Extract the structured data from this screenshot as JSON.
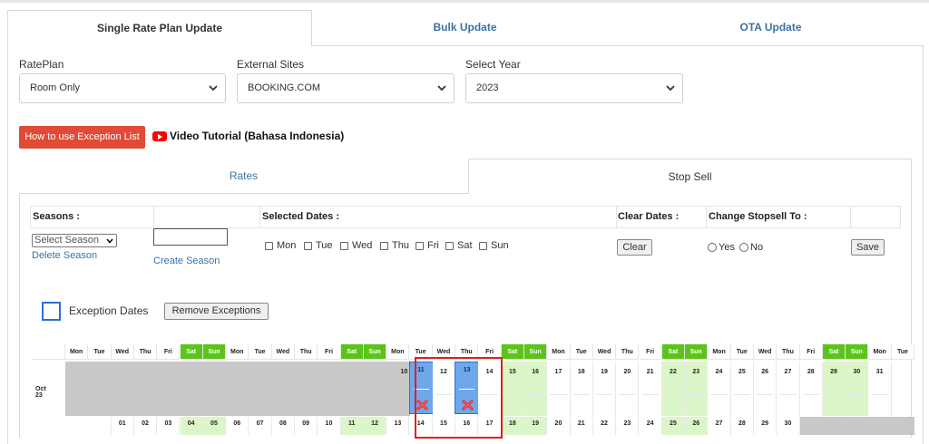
{
  "main_tabs": [
    "Single Rate Plan Update",
    "Bulk Update",
    "OTA Update"
  ],
  "form": {
    "rateplan_label": "RatePlan",
    "rateplan_value": "Room Only",
    "sites_label": "External Sites",
    "sites_value": "BOOKING.COM",
    "year_label": "Select Year",
    "year_value": "2023"
  },
  "help_button": "How to use Exception List",
  "video_link": "Video Tutorial (Bahasa Indonesia)",
  "sub_tabs": [
    "Rates",
    "Stop Sell"
  ],
  "stopsell": {
    "seasons_header": "Seasons :",
    "selected_dates_header": "Selected Dates :",
    "clear_dates_header": "Clear Dates :",
    "change_header": "Change Stopsell To :",
    "season_select": "Select Season",
    "delete_season": "Delete Season",
    "create_season": "Create Season",
    "weekdays": [
      "Mon",
      "Tue",
      "Wed",
      "Thu",
      "Fri",
      "Sat",
      "Sun"
    ],
    "clear_button": "Clear",
    "yes_label": "Yes",
    "no_label": "No",
    "save_button": "Save"
  },
  "exceptions": {
    "label": "Exception Dates",
    "remove_button": "Remove Exceptions"
  },
  "calendar": {
    "header_days": [
      "Mon",
      "Tue",
      "Wed",
      "Thu",
      "Fri",
      "Sat",
      "Sun",
      "Mon",
      "Tue",
      "Wed",
      "Thu",
      "Fri",
      "Sat",
      "Sun",
      "Mon",
      "Tue",
      "Wed",
      "Thu",
      "Fri",
      "Sat",
      "Sun",
      "Mon",
      "Tue",
      "Wed",
      "Thu",
      "Fri",
      "Sat",
      "Sun",
      "Mon",
      "Tue",
      "Wed",
      "Thu",
      "Fri",
      "Sat",
      "Sun",
      "Mon",
      "Tue"
    ],
    "month_label": "Oct 23",
    "oct_days": [
      "10",
      "11",
      "12",
      "13",
      "14",
      "15",
      "16",
      "17",
      "18",
      "19",
      "20",
      "21",
      "22",
      "23",
      "24",
      "25",
      "26",
      "27",
      "28",
      "29",
      "30",
      "31"
    ],
    "oct_exceptions": [
      "11",
      "13"
    ],
    "nov_days": [
      "01",
      "02",
      "03",
      "04",
      "05",
      "06",
      "07",
      "08",
      "09",
      "10",
      "11",
      "12",
      "13",
      "14",
      "15",
      "16",
      "17",
      "18",
      "19",
      "20",
      "21",
      "22",
      "23",
      "24",
      "25",
      "26",
      "27",
      "28",
      "29",
      "30"
    ]
  }
}
